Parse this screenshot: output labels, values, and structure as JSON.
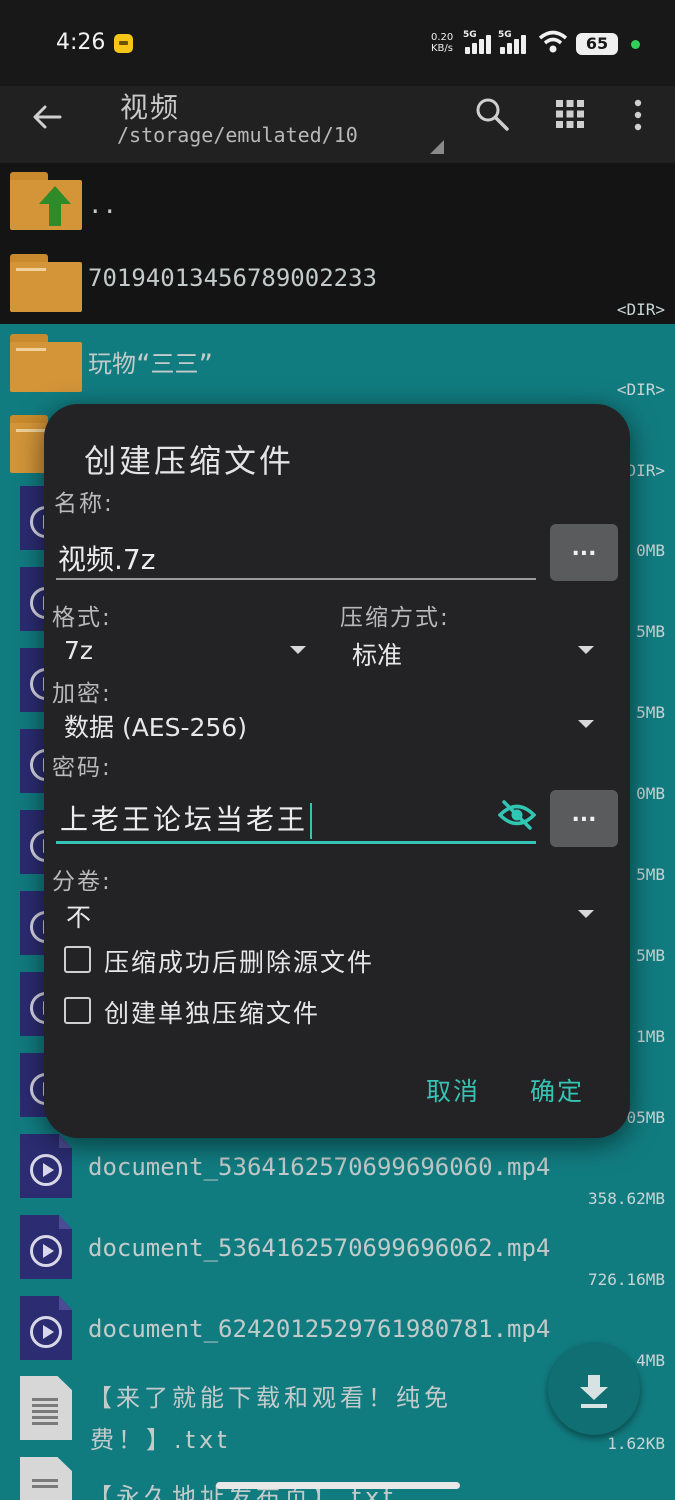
{
  "status_bar": {
    "time": "4:26",
    "net_speed_top": "0.20",
    "net_speed_bottom": "KB/s",
    "signal_label_1": "5G",
    "signal_label_2": "5G",
    "battery": "65"
  },
  "toolbar": {
    "title": "视频",
    "path": "/storage/emulated/10"
  },
  "files": [
    {
      "name": "..",
      "meta": "",
      "type": "folder-up"
    },
    {
      "name": "7019401345678900​2233",
      "meta": "<DIR>",
      "type": "folder"
    },
    {
      "name": "玩物“三三”",
      "meta": "<DIR>",
      "type": "folder"
    },
    {
      "name": "",
      "meta": "<DIR>",
      "type": "folder"
    },
    {
      "name": "",
      "meta": "0MB",
      "type": "video"
    },
    {
      "name": "",
      "meta": "5MB",
      "type": "video"
    },
    {
      "name": "",
      "meta": "5MB",
      "type": "video"
    },
    {
      "name": "",
      "meta": "0MB",
      "type": "video"
    },
    {
      "name": "",
      "meta": "5MB",
      "type": "video"
    },
    {
      "name": "",
      "meta": "5MB",
      "type": "video"
    },
    {
      "name": "",
      "meta": "1MB",
      "type": "video"
    },
    {
      "name": "",
      "meta": "05MB",
      "type": "video"
    },
    {
      "name": "document_5364162570699696060.mp4",
      "meta": "358.62MB",
      "type": "video"
    },
    {
      "name": "document_5364162570699696062.mp4",
      "meta": "726.16MB",
      "type": "video"
    },
    {
      "name": "document_6242012529761980781.mp4",
      "meta": "4MB",
      "type": "video"
    },
    {
      "name": "【来了就能下载和观看！纯免",
      "name2": "费！】.txt",
      "meta": "1.62KB",
      "type": "txt"
    },
    {
      "name": "【永久地址发布页】.txt",
      "meta": "",
      "type": "txt"
    }
  ],
  "dialog": {
    "title": "创建压缩文件",
    "name_label": "名称:",
    "name_value": "视频.7z",
    "browse_label": "...",
    "format_label": "格式:",
    "format_value": "7z",
    "method_label": "压缩方式:",
    "method_value": "标准",
    "encryption_label": "加密:",
    "encryption_value": "数据 (AES-256)",
    "password_label": "密码:",
    "password_value": "上老王论坛当老王",
    "password_btn_label": "...",
    "split_label": "分卷:",
    "split_value": "不",
    "option_delete": "压缩成功后删除源文件",
    "option_separate": "创建单独压缩文件",
    "cancel": "取消",
    "ok": "确定"
  },
  "colors": {
    "accent": "#35c3b4",
    "list_bg": "#117c80",
    "dialog_bg": "#232325",
    "folder": "#d39538"
  }
}
